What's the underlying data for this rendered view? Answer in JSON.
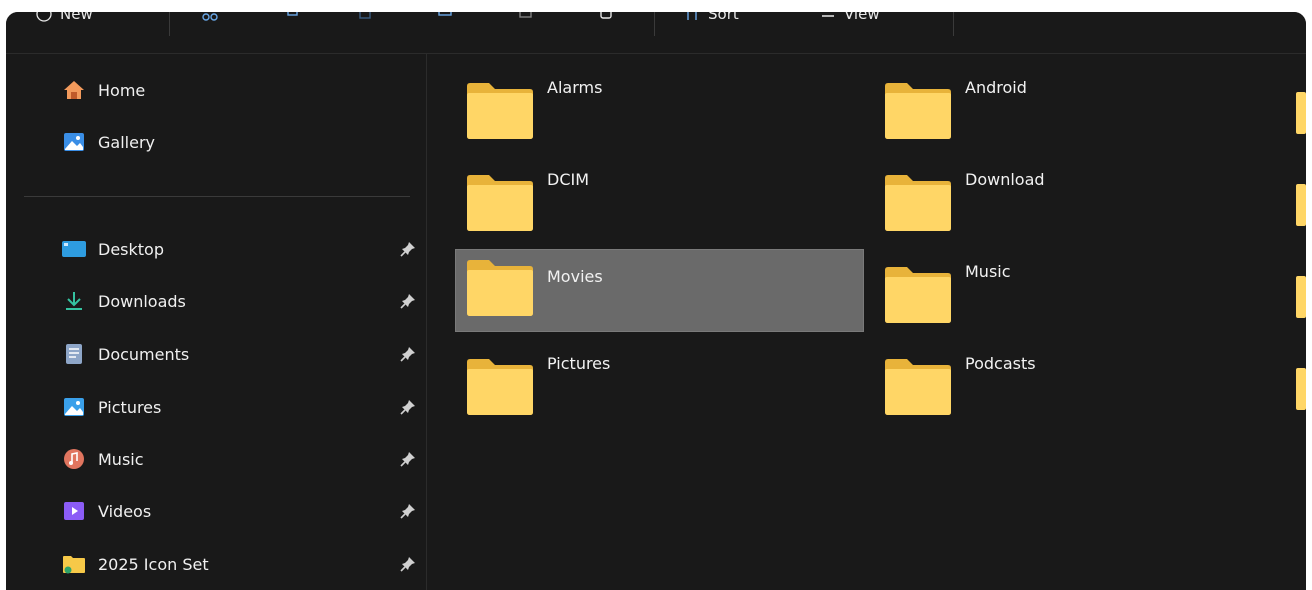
{
  "toolbar": {
    "new_label": "New",
    "sort_label": "Sort",
    "view_label": "View"
  },
  "sidebar": {
    "quick": [
      {
        "label": "Home",
        "icon": "home-icon"
      },
      {
        "label": "Gallery",
        "icon": "gallery-icon"
      }
    ],
    "pinned": [
      {
        "label": "Desktop",
        "icon": "desktop-icon"
      },
      {
        "label": "Downloads",
        "icon": "downloads-icon"
      },
      {
        "label": "Documents",
        "icon": "documents-icon"
      },
      {
        "label": "Pictures",
        "icon": "pictures-icon"
      },
      {
        "label": "Music",
        "icon": "music-icon"
      },
      {
        "label": "Videos",
        "icon": "videos-icon"
      },
      {
        "label": "2025 Icon Set",
        "icon": "folder-icon"
      }
    ]
  },
  "folders": [
    {
      "name": "Alarms"
    },
    {
      "name": "Android"
    },
    {
      "name": "DCIM"
    },
    {
      "name": "Download"
    },
    {
      "name": "Movies",
      "selected": true
    },
    {
      "name": "Music"
    },
    {
      "name": "Pictures"
    },
    {
      "name": "Podcasts"
    }
  ],
  "colors": {
    "background": "#191919",
    "selection": "#6a6a6a",
    "folder": "#f7c948"
  }
}
